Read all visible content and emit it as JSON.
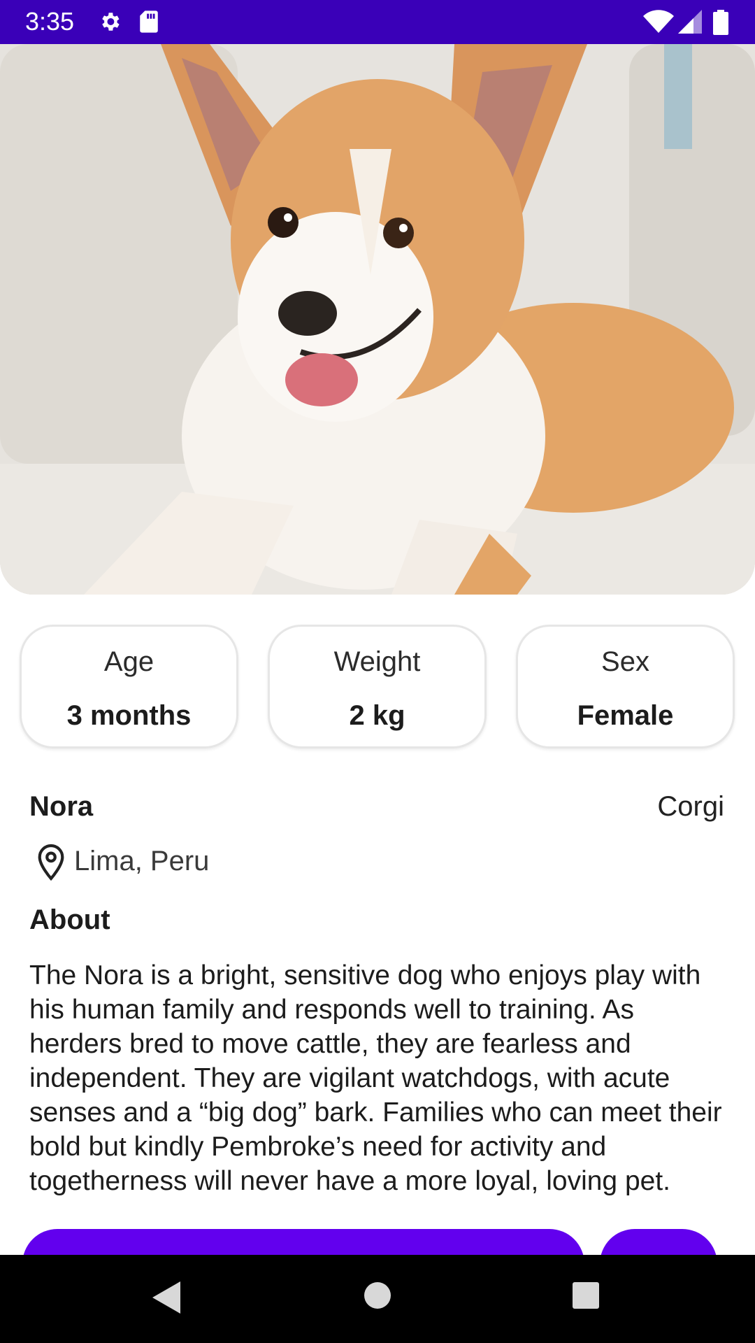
{
  "status_bar": {
    "time": "3:35",
    "icons": [
      "gear-icon",
      "sd-card-icon",
      "wifi-icon",
      "signal-icon",
      "battery-icon"
    ],
    "background": "#3a00b8"
  },
  "stats": [
    {
      "label": "Age",
      "value": "3 months"
    },
    {
      "label": "Weight",
      "value": "2 kg"
    },
    {
      "label": "Sex",
      "value": "Female"
    }
  ],
  "pet": {
    "name": "Nora",
    "breed": "Corgi",
    "location": "Lima, Peru"
  },
  "about": {
    "title": "About",
    "text": "The Nora is a bright, sensitive dog who enjoys play with his human family and responds well to training. As herders bred to move cattle, they are fearless and independent. They are vigilant watchdogs, with acute senses and a “big dog” bark. Families who can meet their bold but kindly Pembroke’s need for activity and togetherness will never have a more loyal, loving pet."
  },
  "colors": {
    "accent": "#6200ee",
    "nav_background": "#000000"
  },
  "nav": [
    "back-icon",
    "home-icon",
    "recents-icon"
  ]
}
